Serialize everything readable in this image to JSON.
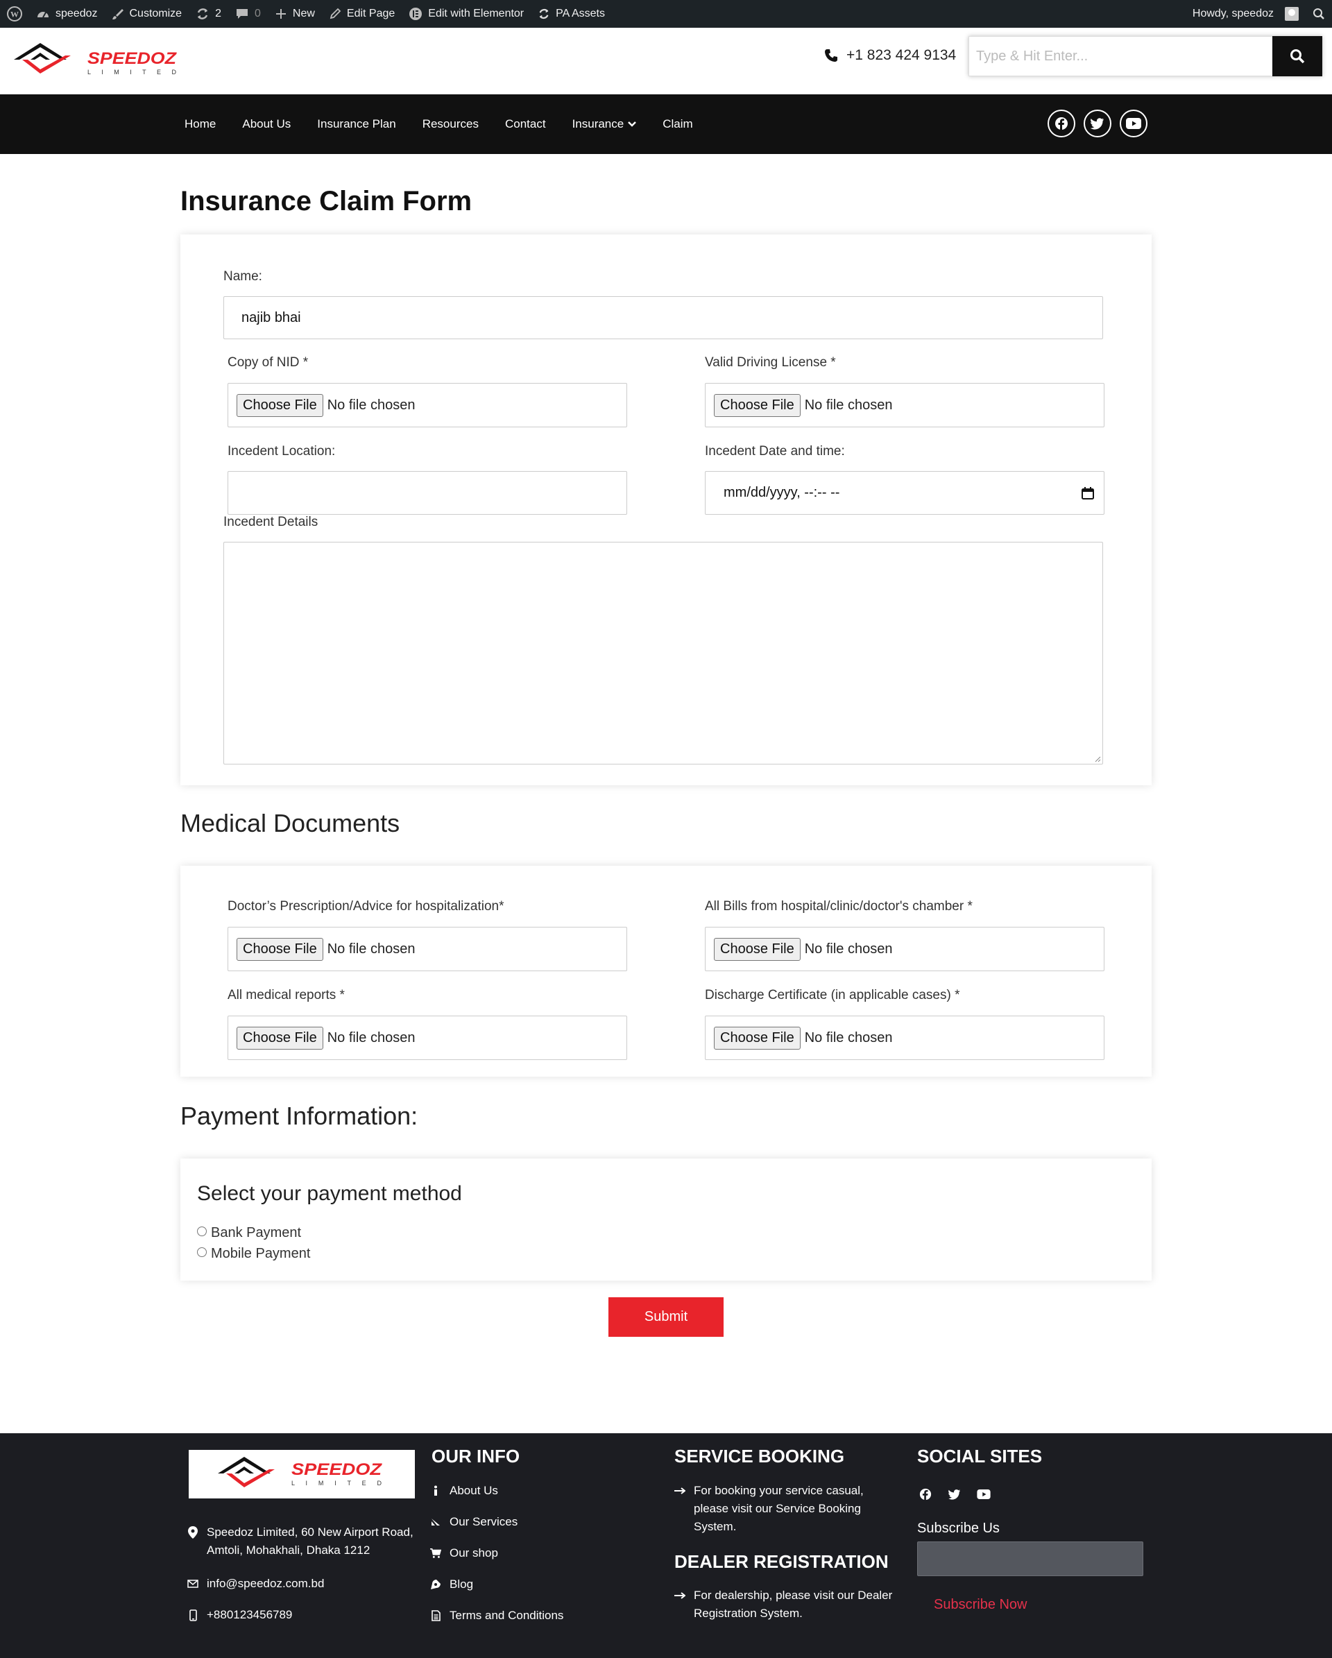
{
  "admin_bar": {
    "site_name": "speedoz",
    "customize": "Customize",
    "updates_count": "2",
    "comments_count": "0",
    "new_label": "New",
    "edit_page": "Edit Page",
    "edit_elementor": "Edit with Elementor",
    "pa_assets": "PA Assets",
    "howdy": "Howdy, speedoz"
  },
  "header": {
    "logo_text": "SPEEDOZ",
    "logo_sub": "L I M I T E D",
    "phone": "+1 823 424 9134",
    "search_placeholder": "Type & Hit Enter..."
  },
  "nav": {
    "items": [
      "Home",
      "About Us",
      "Insurance Plan",
      "Resources",
      "Contact",
      "Insurance",
      "Claim"
    ]
  },
  "form": {
    "title": "Insurance Claim Form",
    "name_label": "Name:",
    "name_value": "najib bhai",
    "nid_label": "Copy of NID *",
    "license_label": "Valid Driving License *",
    "location_label": "Incedent Location:",
    "datetime_label": "Incedent Date and time:",
    "datetime_placeholder": "mm/dd/yyyy, --:-- --",
    "details_label": "Incedent Details",
    "choose_file": "Choose File",
    "no_file": "No file chosen"
  },
  "medical": {
    "title": "Medical Documents",
    "prescription_label": "Doctor’s Prescription/Advice for hospitalization*",
    "bills_label": "All Bills from hospital/clinic/doctor's chamber *",
    "reports_label": "All medical reports *",
    "discharge_label": "Discharge Certificate (in applicable cases) *"
  },
  "payment": {
    "title": "Payment Information:",
    "subtitle": "Select your payment method",
    "options": [
      "Bank Payment",
      "Mobile Payment"
    ]
  },
  "submit_label": "Submit",
  "footer": {
    "address": "Speedoz Limited, 60 New Airport Road, Amtoli, Mohakhali, Dhaka 1212",
    "email": "info@speedoz.com.bd",
    "phone": "+880123456789",
    "our_info_title": "OUR INFO",
    "our_info_links": [
      "About Us",
      "Our Services",
      "Our shop",
      "Blog",
      "Terms and Conditions"
    ],
    "service_booking_title": "SERVICE BOOKING",
    "service_booking_text": "For booking your service casual, please visit our Service Booking System.",
    "dealer_title": "DEALER REGISTRATION",
    "dealer_text": "For dealership, please visit our Dealer Registration System.",
    "social_title": "SOCIAL SITES",
    "subscribe_label": "Subscribe Us",
    "subscribe_button": "Subscribe Now"
  },
  "colors": {
    "accent_red": "#e8242b",
    "admin_bar": "#1d2327",
    "nav_bg": "#111111",
    "footer_bg": "#1c1d22",
    "subscribe_pink": "#e5314b"
  }
}
